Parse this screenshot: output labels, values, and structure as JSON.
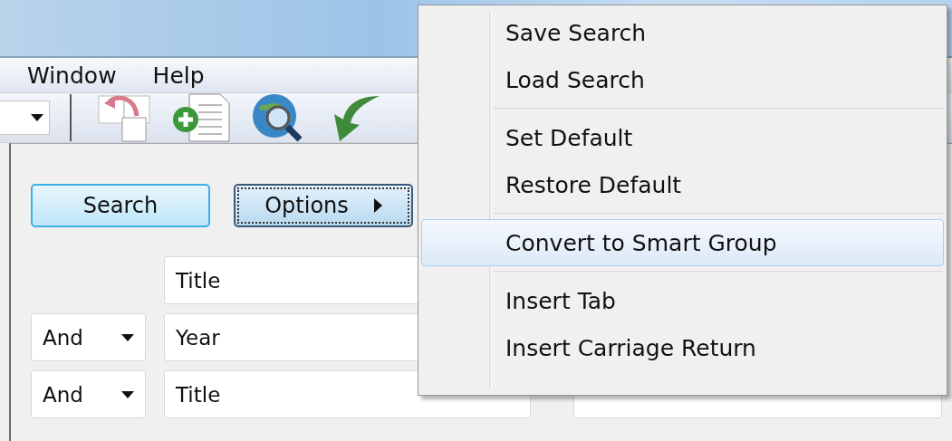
{
  "menu_bar": {
    "items": [
      "Window",
      "Help"
    ]
  },
  "buttons": [
    {
      "label": "Search",
      "kind": "default"
    },
    {
      "label": "Options",
      "kind": "submenu"
    }
  ],
  "criteria": [
    {
      "field": "Title"
    },
    {
      "operator": "And",
      "field": "Year"
    },
    {
      "operator": "And",
      "field": "Title"
    }
  ],
  "context_menu": {
    "items": [
      {
        "kind": "item",
        "label": "Save Search",
        "selected": false
      },
      {
        "kind": "item",
        "label": "Load Search",
        "selected": false
      },
      {
        "kind": "separator"
      },
      {
        "kind": "item",
        "label": "Set Default",
        "selected": false
      },
      {
        "kind": "item",
        "label": "Restore Default",
        "selected": false
      },
      {
        "kind": "separator"
      },
      {
        "kind": "item",
        "label": "Convert to Smart Group",
        "selected": true
      },
      {
        "kind": "separator"
      },
      {
        "kind": "item",
        "label": "Insert Tab",
        "selected": false
      },
      {
        "kind": "item",
        "label": "Insert Carriage Return",
        "selected": false
      }
    ]
  }
}
